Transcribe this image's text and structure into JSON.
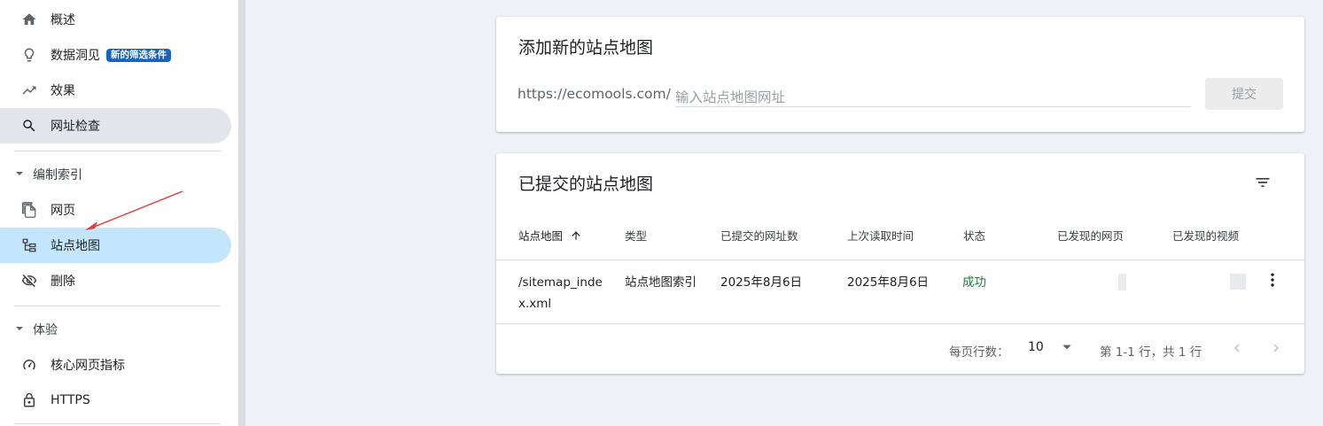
{
  "sidebar": {
    "items": [
      {
        "label": "概述",
        "icon": "home-icon"
      },
      {
        "label": "数据洞见",
        "icon": "lightbulb-icon",
        "badge": "新的筛选条件"
      },
      {
        "label": "效果",
        "icon": "trending-up-icon"
      },
      {
        "label": "网址检查",
        "icon": "search-icon"
      }
    ],
    "section_index": {
      "title": "编制索引",
      "items": [
        {
          "label": "网页",
          "icon": "pages-icon"
        },
        {
          "label": "站点地图",
          "icon": "sitemap-icon"
        },
        {
          "label": "删除",
          "icon": "eye-off-icon"
        }
      ]
    },
    "section_experience": {
      "title": "体验",
      "items": [
        {
          "label": "核心网页指标",
          "icon": "speedometer-icon"
        },
        {
          "label": "HTTPS",
          "icon": "lock-icon"
        }
      ]
    }
  },
  "add_sitemap": {
    "title": "添加新的站点地图",
    "url_prefix": "https://ecomools.com/",
    "input_placeholder": "输入站点地图网址",
    "input_value": "",
    "submit_label": "提交"
  },
  "submitted": {
    "title": "已提交的站点地图",
    "columns": {
      "sitemap": "站点地图",
      "type": "类型",
      "submitted_urls": "已提交的网址数",
      "last_read": "上次读取时间",
      "status": "状态",
      "discovered_pages": "已发现的网页",
      "discovered_videos": "已发现的视频"
    },
    "rows": [
      {
        "sitemap": "/sitemap_index.xml",
        "type": "站点地图索引",
        "submitted_urls": "2025年8月6日",
        "last_read": "2025年8月6日",
        "status": "成功"
      }
    ],
    "footer": {
      "rows_per_page_label": "每页行数：",
      "rows_per_page": "10",
      "range_text": "第 1-1 行，共 1 行"
    }
  },
  "colors": {
    "active_nav": "#c4e6fc",
    "badge": "#1565c0",
    "status_success": "#188038",
    "annotation_arrow": "#e53935"
  }
}
